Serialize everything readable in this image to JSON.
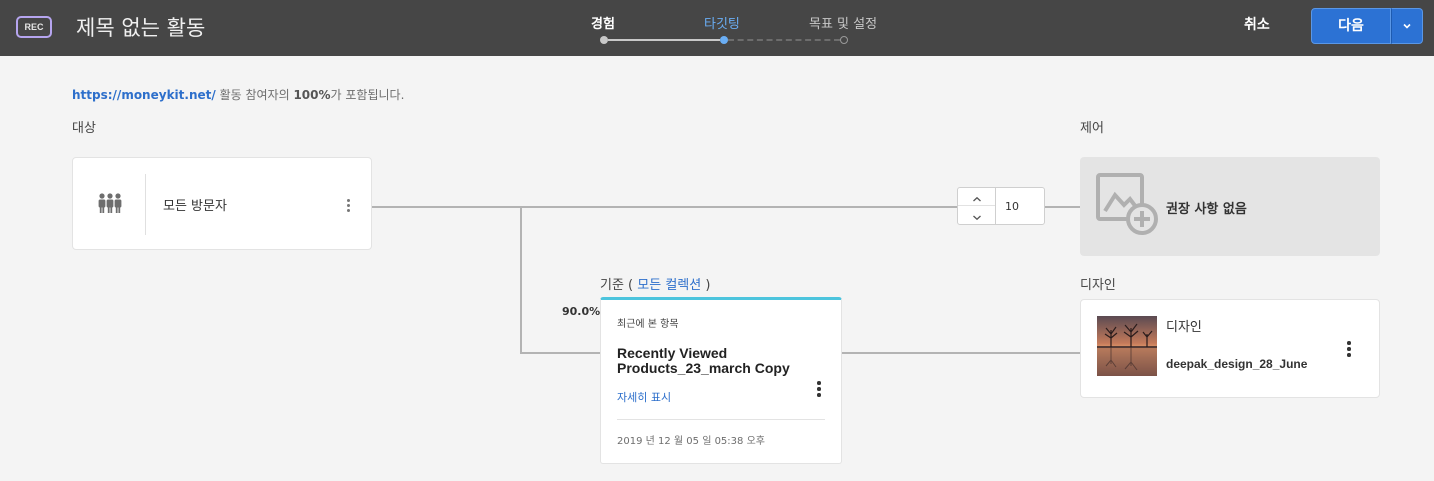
{
  "header": {
    "rec_badge": "REC",
    "title": "제목 없는 활동",
    "steps": [
      {
        "label": "경험",
        "state": "done"
      },
      {
        "label": "타깃팅",
        "state": "active"
      },
      {
        "label": "목표 및 설정",
        "state": "pending"
      }
    ],
    "cancel_label": "취소",
    "next_label": "다음",
    "accent_color": "#2c72d4"
  },
  "info": {
    "url": "https://moneykit.net/",
    "text_before_pct": " 활동 참여자의 ",
    "pct": "100%",
    "text_after_pct": "가 포함됩니다."
  },
  "audience": {
    "section_label": "대상",
    "name": "모든 방문자",
    "icon": "people-icon"
  },
  "control": {
    "section_label": "제어",
    "text": "권장 사항 없음",
    "icon": "image-add-icon"
  },
  "split": {
    "value": "10"
  },
  "criteria": {
    "label_prefix": "기준 ( ",
    "collection_link": "모든 컬렉션",
    "label_suffix": " )",
    "percentage": "90.0%",
    "subtitle": "최근에 본 항목",
    "title": "Recently Viewed Products_23_march Copy",
    "more_link": "자세히 표시",
    "date": "2019 년 12 월 05 일 05:38 오후",
    "accent_color": "#4cc4dd"
  },
  "design": {
    "section_label": "디자인",
    "type": "디자인",
    "name": "deepak_design_28_June"
  }
}
